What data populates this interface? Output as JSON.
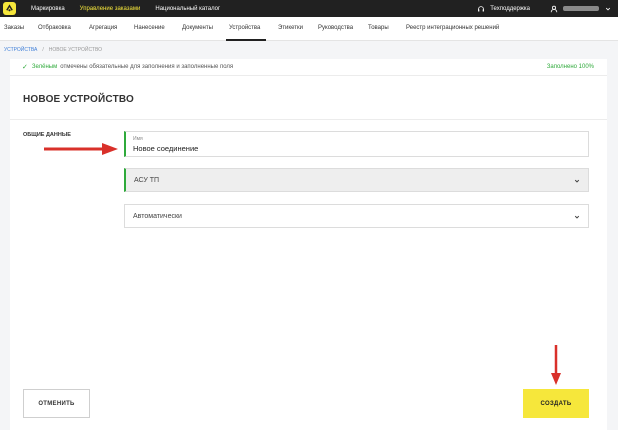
{
  "topbar": {
    "nav": [
      {
        "label": "Маркировка",
        "active": false
      },
      {
        "label": "Управление заказами",
        "active": true
      },
      {
        "label": "Национальный каталог",
        "active": false
      }
    ],
    "support_label": "Техподдержка",
    "icons": [
      "app-logo-icon",
      "headset-icon",
      "user-icon",
      "chevron-down-icon"
    ]
  },
  "tabs": [
    {
      "label": "Заказы"
    },
    {
      "label": "Отбраковка"
    },
    {
      "label": "Агрегация"
    },
    {
      "label": "Нанесение"
    },
    {
      "label": "Документы"
    },
    {
      "label": "Устройства",
      "active": true
    },
    {
      "label": "Этикетки"
    },
    {
      "label": "Руководства"
    },
    {
      "label": "Товары"
    },
    {
      "label": "Реестр интеграционных решений"
    }
  ],
  "breadcrumb": {
    "root": "УСТРОЙСТВА",
    "separator": "/",
    "current": "НОВОЕ УСТРОЙСТВО"
  },
  "notice": {
    "highlight": "Зелёным",
    "text": "отмечены обязательные для заполнения и заполненные поля",
    "status": "Заполнено 100%"
  },
  "form": {
    "title": "НОВОЕ УСТРОЙСТВО",
    "section_label": "ОБЩИЕ ДАННЫЕ",
    "name_label": "Имя",
    "name_value": "Новое соединение",
    "type_value": "АСУ ТП",
    "mode_value": "Автоматически"
  },
  "buttons": {
    "cancel": "ОТМЕНИТЬ",
    "create": "СОЗДАТЬ"
  },
  "colors": {
    "accent_yellow": "#f6e73b",
    "required_green": "#2faa3b",
    "arrow_red": "#d9302a",
    "topbar_bg": "#212121"
  }
}
